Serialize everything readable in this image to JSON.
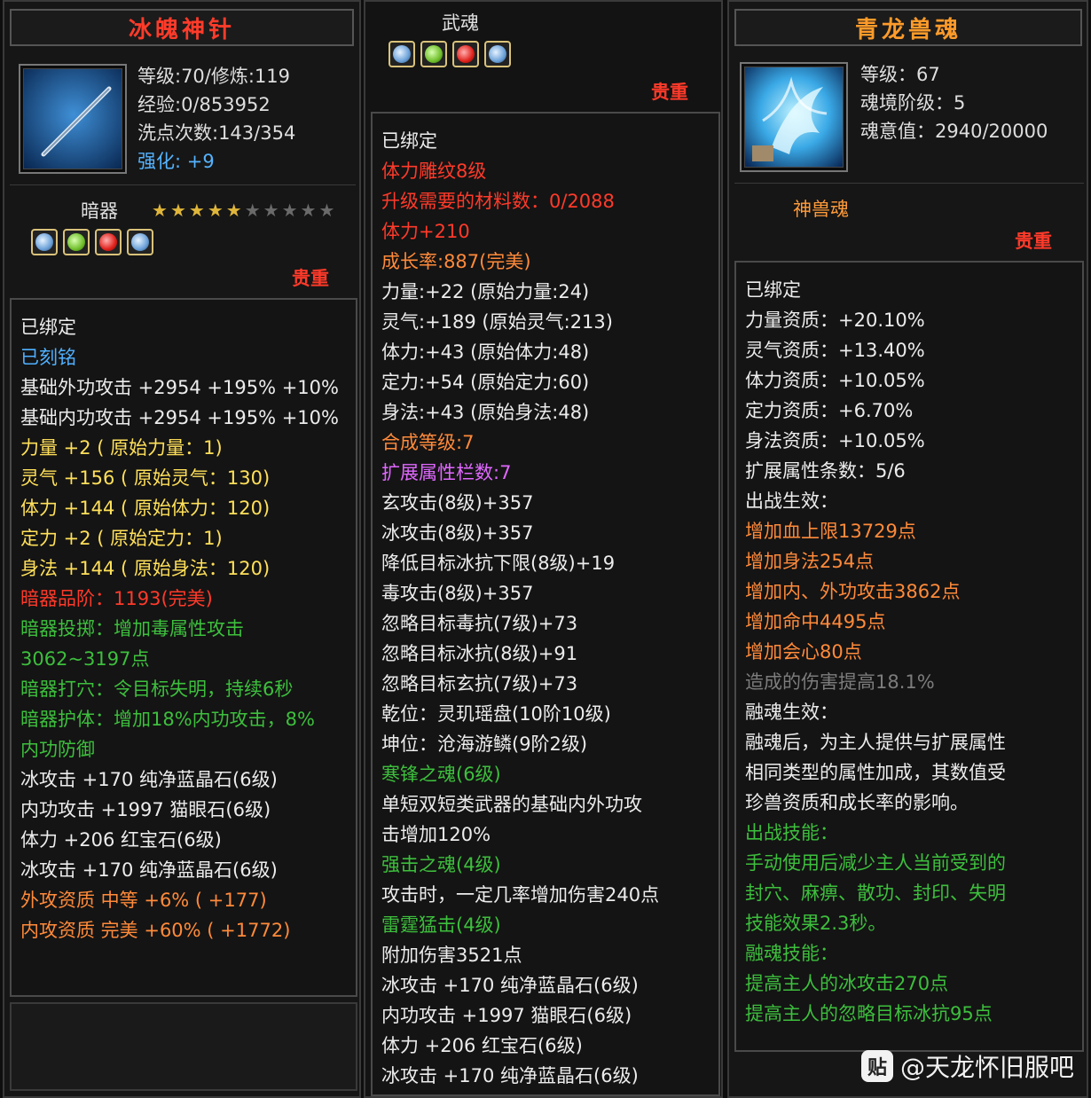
{
  "left": {
    "title": "冰魄神针",
    "header_lines": [
      "等级:70/修炼:119",
      "经验:0/853952",
      "洗点次数:143/354"
    ],
    "enhance_label": "强化: +9",
    "category": "暗器",
    "stars_total": 10,
    "stars_filled": 5,
    "gems": [
      "blue",
      "green",
      "red",
      "blue"
    ],
    "tag": "贵重",
    "lines": [
      {
        "t": "已绑定",
        "c": "w"
      },
      {
        "t": "已刻铭",
        "c": "b"
      },
      {
        "t": "基础外功攻击 +2954 +195% +10%",
        "c": "w"
      },
      {
        "t": "基础内功攻击 +2954 +195% +10%",
        "c": "w"
      },
      {
        "t": "力量 +2 ( 原始力量：1)",
        "c": "y"
      },
      {
        "t": "灵气 +156 ( 原始灵气：130)",
        "c": "y"
      },
      {
        "t": "体力 +144 ( 原始体力：120)",
        "c": "y"
      },
      {
        "t": "定力 +2 ( 原始定力：1)",
        "c": "y"
      },
      {
        "t": "身法 +144 ( 原始身法：120)",
        "c": "y"
      },
      {
        "t": "暗器品阶：1193(完美)",
        "c": "r"
      },
      {
        "t": "暗器投掷：增加毒属性攻击",
        "c": "g"
      },
      {
        "t": "3062~3197点",
        "c": "g"
      },
      {
        "t": "暗器打穴：令目标失明，持续6秒",
        "c": "g"
      },
      {
        "t": "暗器护体：增加18%内功攻击，8%",
        "c": "g"
      },
      {
        "t": "内功防御",
        "c": "g"
      },
      {
        "t": "冰攻击 +170 纯净蓝晶石(6级)",
        "c": "w"
      },
      {
        "t": "内功攻击 +1997 猫眼石(6级)",
        "c": "w"
      },
      {
        "t": "体力 +206 红宝石(6级)",
        "c": "w"
      },
      {
        "t": "冰攻击 +170 纯净蓝晶石(6级)",
        "c": "w"
      },
      {
        "t": "外攻资质   中等 +6% ( +177)",
        "c": "o"
      },
      {
        "t": "内攻资质   完美 +60% ( +1772)",
        "c": "o"
      }
    ]
  },
  "mid": {
    "title": "武魂",
    "gems": [
      "blue",
      "green",
      "red",
      "blue"
    ],
    "tag": "贵重",
    "lines": [
      {
        "t": "已绑定",
        "c": "w"
      },
      {
        "t": "体力雕纹8级",
        "c": "r"
      },
      {
        "t": "升级需要的材料数：0/2088",
        "c": "r"
      },
      {
        "t": "体力+210",
        "c": "r"
      },
      {
        "t": "成长率:887(完美)",
        "c": "o"
      },
      {
        "t": "力量:+22 (原始力量:24)",
        "c": "w"
      },
      {
        "t": "灵气:+189 (原始灵气:213)",
        "c": "w"
      },
      {
        "t": "体力:+43 (原始体力:48)",
        "c": "w"
      },
      {
        "t": "定力:+54 (原始定力:60)",
        "c": "w"
      },
      {
        "t": "身法:+43 (原始身法:48)",
        "c": "w"
      },
      {
        "t": "合成等级:7",
        "c": "o"
      },
      {
        "t": "扩展属性栏数:7",
        "c": "p"
      },
      {
        "t": "玄攻击(8级)+357",
        "c": "w"
      },
      {
        "t": "冰攻击(8级)+357",
        "c": "w"
      },
      {
        "t": "降低目标冰抗下限(8级)+19",
        "c": "w"
      },
      {
        "t": "毒攻击(8级)+357",
        "c": "w"
      },
      {
        "t": "忽略目标毒抗(7级)+73",
        "c": "w"
      },
      {
        "t": "忽略目标冰抗(8级)+91",
        "c": "w"
      },
      {
        "t": "忽略目标玄抗(7级)+73",
        "c": "w"
      },
      {
        "t": "乾位：灵玑瑶盘(10阶10级)",
        "c": "w"
      },
      {
        "t": "坤位：沧海游鳞(9阶2级)",
        "c": "w"
      },
      {
        "t": "寒锋之魂(6级)",
        "c": "g"
      },
      {
        "t": "单短双短类武器的基础内外功攻",
        "c": "w"
      },
      {
        "t": "击增加120%",
        "c": "w"
      },
      {
        "t": "强击之魂(4级)",
        "c": "g"
      },
      {
        "t": "攻击时，一定几率增加伤害240点",
        "c": "w"
      },
      {
        "t": "雷霆猛击(4级)",
        "c": "g"
      },
      {
        "t": "附加伤害3521点",
        "c": "w"
      },
      {
        "t": "冰攻击 +170 纯净蓝晶石(6级)",
        "c": "w"
      },
      {
        "t": "内功攻击 +1997 猫眼石(6级)",
        "c": "w"
      },
      {
        "t": "体力 +206 红宝石(6级)",
        "c": "w"
      },
      {
        "t": "冰攻击 +170 纯净蓝晶石(6级)",
        "c": "w"
      }
    ]
  },
  "right": {
    "title": "青龙兽魂",
    "header_lines": [
      "等级：67",
      "魂境阶级：5",
      "魂意值：2940/20000"
    ],
    "category": "神兽魂",
    "tag": "贵重",
    "lines": [
      {
        "t": "已绑定",
        "c": "w"
      },
      {
        "t": "力量资质：+20.10%",
        "c": "w"
      },
      {
        "t": "灵气资质：+13.40%",
        "c": "w"
      },
      {
        "t": "体力资质：+10.05%",
        "c": "w"
      },
      {
        "t": "定力资质：+6.70%",
        "c": "w"
      },
      {
        "t": "身法资质：+10.05%",
        "c": "w"
      },
      {
        "t": "扩展属性条数：5/6",
        "c": "w"
      },
      {
        "t": "出战生效：",
        "c": "w"
      },
      {
        "t": "增加血上限13729点",
        "c": "o"
      },
      {
        "t": "增加身法254点",
        "c": "o"
      },
      {
        "t": "增加内、外功攻击3862点",
        "c": "o"
      },
      {
        "t": "增加命中4495点",
        "c": "o"
      },
      {
        "t": "增加会心80点",
        "c": "o"
      },
      {
        "t": "造成的伤害提高18.1%",
        "c": "gray"
      },
      {
        "t": "融魂生效：",
        "c": "w"
      },
      {
        "t": "融魂后，为主人提供与扩展属性",
        "c": "w"
      },
      {
        "t": "相同类型的属性加成，其数值受",
        "c": "w"
      },
      {
        "t": "珍兽资质和成长率的影响。",
        "c": "w"
      },
      {
        "t": "出战技能：",
        "c": "g"
      },
      {
        "t": "手动使用后减少主人当前受到的",
        "c": "g"
      },
      {
        "t": "封穴、麻痹、散功、封印、失明",
        "c": "g"
      },
      {
        "t": "技能效果2.3秒。",
        "c": "g"
      },
      {
        "t": "融魂技能：",
        "c": "g"
      },
      {
        "t": "提高主人的冰攻击270点",
        "c": "g"
      },
      {
        "t": "提高主人的忽略目标冰抗95点",
        "c": "g"
      }
    ]
  },
  "watermark": "@天龙怀旧服吧",
  "watermark_logo": "贴"
}
